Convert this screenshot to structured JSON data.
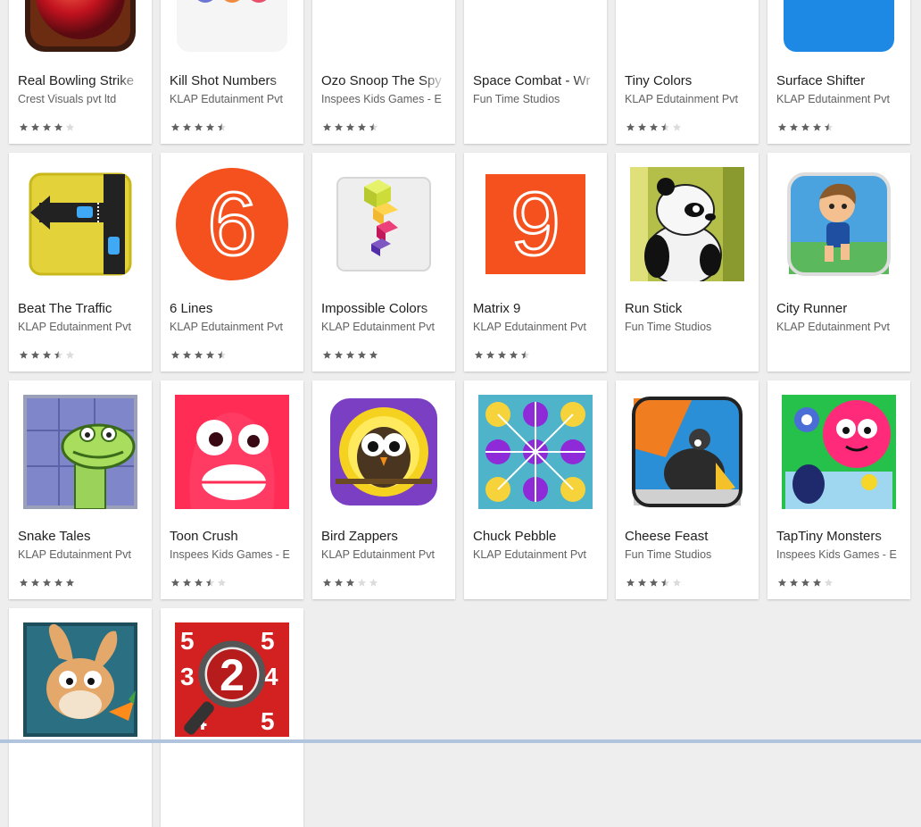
{
  "apps": [
    {
      "title": "Real Bowling Strike",
      "developer": "Crest Visuals pvt ltd",
      "rating": 4,
      "icon": "bowling-ball-icon"
    },
    {
      "title": "Kill Shot Numbers",
      "developer": "KLAP Edutainment Pvt",
      "rating": 4.5,
      "icon": "colored-dots-icon"
    },
    {
      "title": "Ozo Snoop The Spy",
      "developer": "Inspees Kids Games - E",
      "rating": 4.8,
      "icon": "blue-diamond-icon"
    },
    {
      "title": "Space Combat - Wr",
      "developer": "Fun Time Studios",
      "rating": null,
      "icon": "spaceship-icon"
    },
    {
      "title": "Tiny Colors",
      "developer": "KLAP Edutainment Pvt",
      "rating": 3.5,
      "icon": "color-diamond-icon"
    },
    {
      "title": "Surface Shifter",
      "developer": "KLAP Edutainment Pvt",
      "rating": 4.8,
      "icon": "window-tiles-icon"
    },
    {
      "title": "Beat The Traffic",
      "developer": "KLAP Edutainment Pvt",
      "rating": 3.5,
      "icon": "traffic-cars-icon"
    },
    {
      "title": "6 Lines",
      "developer": "KLAP Edutainment Pvt",
      "rating": 4.5,
      "icon": "number-six-icon"
    },
    {
      "title": "Impossible Colors",
      "developer": "KLAP Edutainment Pvt",
      "rating": 5,
      "icon": "stacked-cubes-icon"
    },
    {
      "title": "Matrix 9",
      "developer": "KLAP Edutainment Pvt",
      "rating": 4.8,
      "icon": "number-nine-icon"
    },
    {
      "title": "Run Stick",
      "developer": "Fun Time Studios",
      "rating": null,
      "icon": "panda-icon"
    },
    {
      "title": "City Runner",
      "developer": "KLAP Edutainment Pvt",
      "rating": null,
      "icon": "running-boy-icon"
    },
    {
      "title": "Snake Tales",
      "developer": "KLAP Edutainment Pvt",
      "rating": 5,
      "icon": "snake-icon"
    },
    {
      "title": "Toon Crush",
      "developer": "Inspees Kids Games - E",
      "rating": 3.5,
      "icon": "red-monster-icon"
    },
    {
      "title": "Bird Zappers",
      "developer": "KLAP Edutainment Pvt",
      "rating": 3,
      "icon": "bird-icon"
    },
    {
      "title": "Chuck Pebble",
      "developer": "KLAP Edutainment Pvt",
      "rating": null,
      "icon": "pebble-grid-icon"
    },
    {
      "title": "Cheese Feast",
      "developer": "Fun Time Studios",
      "rating": 3.5,
      "icon": "rat-cheese-icon"
    },
    {
      "title": "TapTiny Monsters",
      "developer": "Inspees Kids Games - E",
      "rating": 4,
      "icon": "pink-monster-icon"
    },
    {
      "title": "",
      "developer": "",
      "rating": null,
      "icon": "rabbit-icon"
    },
    {
      "title": "",
      "developer": "",
      "rating": null,
      "icon": "magnifier-number-icon"
    }
  ],
  "colors": {
    "page_background": "#eeeeee",
    "card_background": "#ffffff",
    "title_text": "#212121",
    "developer_text": "#616161",
    "star_filled": "#616161",
    "star_empty": "#dcdcdc"
  }
}
